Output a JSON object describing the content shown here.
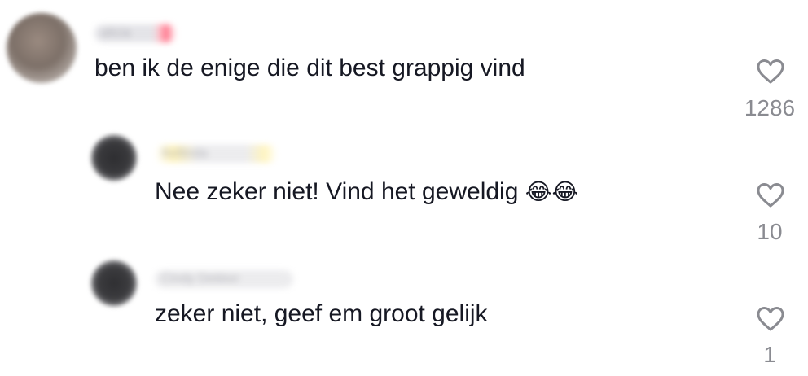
{
  "comments": [
    {
      "username": "alicia",
      "text": "ben ik de enige die dit best grappig vind",
      "emoji": "",
      "likes": "1286",
      "avatar_color": "#7d7068"
    },
    {
      "username": "Bellinda",
      "text": "Nee zeker niet! Vind het geweldig",
      "emoji": "😂😂",
      "likes": "10",
      "avatar_color": "#3a3a3d"
    },
    {
      "username": "Cindy Dekker",
      "text": "zeker niet, geef em groot gelijk",
      "emoji": "",
      "likes": "1",
      "avatar_color": "#3c3c3f"
    }
  ],
  "icons": {
    "like": "heart-outline-icon",
    "emoji": "tears-of-joy-emoji"
  },
  "colors": {
    "text": "#161823",
    "secondary": "#8a8b91",
    "verified_badge": "#ff4d6d",
    "username_highlight": "#fff1a8"
  }
}
